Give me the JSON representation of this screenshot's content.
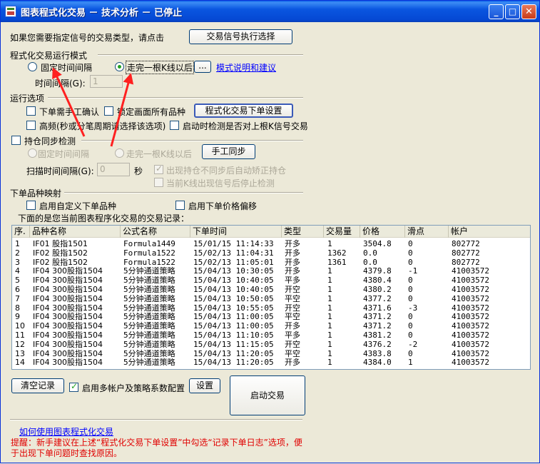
{
  "window": {
    "title": "图表程式化交易 － 技术分析 － 已停止",
    "min": "_",
    "max": "□",
    "close": "✕"
  },
  "signal": {
    "prompt": "如果您需要指定信号的交易类型，请点击",
    "button": "交易信号执行选择"
  },
  "mode": {
    "label": "程式化交易运行模式",
    "fixed": "固定时间间隔",
    "kline": "走完一根K线以后",
    "dots": "...",
    "link": "模式说明和建议",
    "interval_label": "时间间隔(G):",
    "interval_value": "1"
  },
  "options": {
    "label": "运行选项",
    "manual_confirm": "下单需手工确认",
    "lock_screen": "锁定画面所有品种",
    "order_settings": "程式化交易下单设置",
    "high_freq": "高频(秒或分笔周期请选择该选项)",
    "startup_check": "启动时检测是否对上根K信号交易"
  },
  "sync": {
    "label": "持仓同步检测",
    "fixed": "固定时间间隔",
    "kline": "走完一根K线以后",
    "manual": "手工同步",
    "scan_label": "扫描时间间隔(G):",
    "scan_value": "0",
    "unit": "秒",
    "auto_fix": "出现持仓不同步后自动矫正持仓",
    "stop_detect": "当前K线出现信号后停止检测"
  },
  "mapping": {
    "label": "下单品种映射",
    "custom_symbol": "启用自定义下单品种",
    "price_offset": "启用下单价格偏移"
  },
  "records": {
    "caption": "下面的是您当前图表程序化交易的交易记录：",
    "headers": [
      "序.",
      "品种名称",
      "公式名称",
      "下单时间",
      "类型",
      "交易量",
      "价格",
      "滑点",
      "帐户"
    ],
    "rows": [
      [
        "1",
        "IF01 股指1501",
        "Formula1449",
        "15/01/15 11:14:33",
        "开多",
        "1",
        "3504.8",
        "0",
        "802772"
      ],
      [
        "2",
        "IF02 股指1502",
        "Formula1522",
        "15/02/13 11:04:31",
        "开多",
        "1362",
        "0.0",
        "0",
        "802772"
      ],
      [
        "3",
        "IF02 股指1502",
        "Formula1522",
        "15/02/13 11:05:01",
        "开多",
        "1361",
        "0.0",
        "0",
        "802772"
      ],
      [
        "4",
        "IF04 300股指1504",
        "5分钟通道策略",
        "15/04/13 10:30:05",
        "开多",
        "1",
        "4379.8",
        "-1",
        "41003572"
      ],
      [
        "5",
        "IF04 300股指1504",
        "5分钟通道策略",
        "15/04/13 10:40:05",
        "平多",
        "1",
        "4380.4",
        "0",
        "41003572"
      ],
      [
        "6",
        "IF04 300股指1504",
        "5分钟通道策略",
        "15/04/13 10:40:05",
        "开空",
        "1",
        "4380.2",
        "0",
        "41003572"
      ],
      [
        "7",
        "IF04 300股指1504",
        "5分钟通道策略",
        "15/04/13 10:50:05",
        "平空",
        "1",
        "4377.2",
        "0",
        "41003572"
      ],
      [
        "8",
        "IF04 300股指1504",
        "5分钟通道策略",
        "15/04/13 10:55:05",
        "开空",
        "1",
        "4371.6",
        "-3",
        "41003572"
      ],
      [
        "9",
        "IF04 300股指1504",
        "5分钟通道策略",
        "15/04/13 11:00:05",
        "平空",
        "1",
        "4371.2",
        "0",
        "41003572"
      ],
      [
        "10",
        "IF04 300股指1504",
        "5分钟通道策略",
        "15/04/13 11:00:05",
        "开多",
        "1",
        "4371.2",
        "0",
        "41003572"
      ],
      [
        "11",
        "IF04 300股指1504",
        "5分钟通道策略",
        "15/04/13 11:10:05",
        "平多",
        "1",
        "4381.2",
        "0",
        "41003572"
      ],
      [
        "12",
        "IF04 300股指1504",
        "5分钟通道策略",
        "15/04/13 11:15:05",
        "开空",
        "1",
        "4376.2",
        "-2",
        "41003572"
      ],
      [
        "13",
        "IF04 300股指1504",
        "5分钟通道策略",
        "15/04/13 11:20:05",
        "平空",
        "1",
        "4383.8",
        "0",
        "41003572"
      ],
      [
        "14",
        "IF04 300股指1504",
        "5分钟通道策略",
        "15/04/13 11:20:05",
        "开多",
        "1",
        "4384.0",
        "1",
        "41003572"
      ]
    ]
  },
  "bottom": {
    "clear": "清空记录",
    "multi_account": "启用多帐户及策略系数配置",
    "settings": "设置",
    "start": "启动交易",
    "help_link": "如何使用图表程式化交易",
    "tip": "提醒：新手建议在上述“程式化交易下单设置”中勾选“记录下单日志”选项，便于出现下单问题时查找原因。"
  },
  "colors": {
    "titlebar": "#0a56e0",
    "face": "#ece9d8",
    "link": "#0000ff",
    "tip": "#e00000",
    "arrow": "#ff2020"
  }
}
